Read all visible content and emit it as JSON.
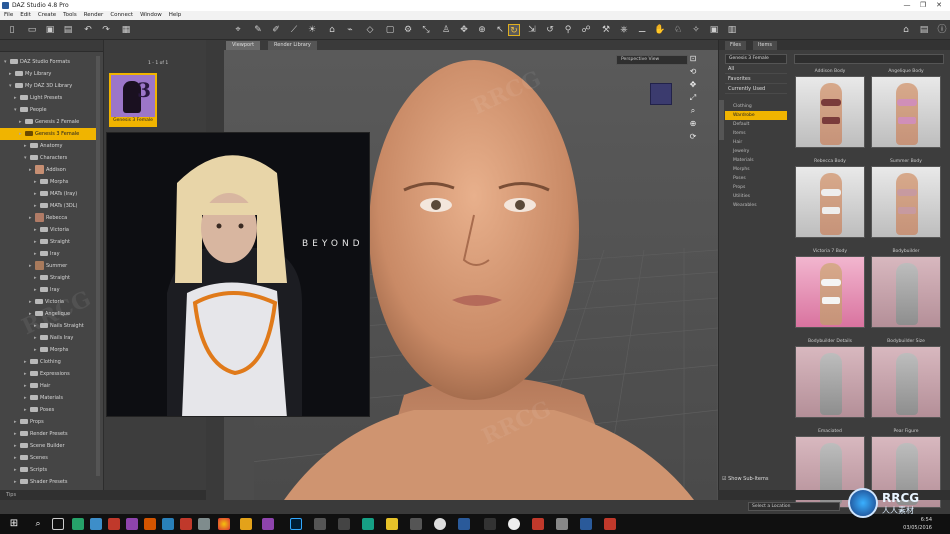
{
  "window": {
    "title": "DAZ Studio 4.8 Pro",
    "controls": [
      "—",
      "❐",
      "✕"
    ]
  },
  "menu": [
    "File",
    "Edit",
    "Create",
    "Tools",
    "Render",
    "Connect",
    "Window",
    "Help"
  ],
  "viewport": {
    "tabs": [
      "Viewport",
      "Render Library"
    ],
    "camera": "Perspective View",
    "promo_text": "BEYOND"
  },
  "content_library": {
    "page_indicator": "1 - 1 of 1",
    "tree": [
      {
        "label": "DAZ Studio Formats",
        "depth": 0,
        "open": true
      },
      {
        "label": "My Library",
        "depth": 1
      },
      {
        "label": "My DAZ 3D Library",
        "depth": 1,
        "open": true
      },
      {
        "label": "Light Presets",
        "depth": 2
      },
      {
        "label": "People",
        "depth": 2,
        "open": true
      },
      {
        "label": "Genesis 2 Female",
        "depth": 3
      },
      {
        "label": "Genesis 3 Female",
        "depth": 3,
        "selected": true
      },
      {
        "label": "Anatomy",
        "depth": 4
      },
      {
        "label": "Characters",
        "depth": 4,
        "open": true
      },
      {
        "label": "Addison",
        "depth": 5,
        "thumb": "#c78f73"
      },
      {
        "label": "Morphs",
        "depth": 6
      },
      {
        "label": "MATs (Iray)",
        "depth": 6
      },
      {
        "label": "MATs (3DL)",
        "depth": 6
      },
      {
        "label": "Rebecca",
        "depth": 5,
        "thumb": "#b07b66"
      },
      {
        "label": "Victoria",
        "depth": 6
      },
      {
        "label": "Straight",
        "depth": 6
      },
      {
        "label": "Iray",
        "depth": 6
      },
      {
        "label": "Summer",
        "depth": 5,
        "thumb": "#a87a5c"
      },
      {
        "label": "Straight",
        "depth": 6
      },
      {
        "label": "Iray",
        "depth": 6
      },
      {
        "label": "Victoria",
        "depth": 5
      },
      {
        "label": "Angelique",
        "depth": 5
      },
      {
        "label": "Nails Straight",
        "depth": 6
      },
      {
        "label": "Nails Iray",
        "depth": 6
      },
      {
        "label": "Morphs",
        "depth": 6
      },
      {
        "label": "Clothing",
        "depth": 4
      },
      {
        "label": "Expressions",
        "depth": 4
      },
      {
        "label": "Hair",
        "depth": 4
      },
      {
        "label": "Materials",
        "depth": 4
      },
      {
        "label": "Poses",
        "depth": 4
      },
      {
        "label": "Props",
        "depth": 2
      },
      {
        "label": "Render Presets",
        "depth": 2
      },
      {
        "label": "Scene Builder",
        "depth": 2
      },
      {
        "label": "Scenes",
        "depth": 2
      },
      {
        "label": "Scripts",
        "depth": 2
      },
      {
        "label": "Shader Presets",
        "depth": 2
      }
    ],
    "selected_item": "Genesis 3 Female",
    "tip_label": "Tips"
  },
  "smart_content": {
    "tabs": [
      "Files",
      "Items"
    ],
    "filter": "Genesis 3 Female",
    "options": [
      "All",
      "Favorites",
      "Currently Used"
    ],
    "tree": [
      "Clothing",
      "Wardrobe",
      "Default",
      "Items",
      "Hair",
      "Jewelry",
      "Materials",
      "Morphs",
      "Poses",
      "Props",
      "Utilities",
      "Wearables"
    ],
    "tree_selected": "Wardrobe",
    "cards": [
      {
        "title": "Addison Body",
        "skin": "skin",
        "top": "#7a3b3b",
        "bottom": "#7a3b3b"
      },
      {
        "title": "Angelique Body",
        "skin": "skin",
        "top": "#d08fb8",
        "bottom": "#d08fb8"
      },
      {
        "title": "Rebecca Body",
        "skin": "skin",
        "top": "#eeeeee",
        "bottom": "#eeeeee"
      },
      {
        "title": "Summer Body",
        "skin": "skin",
        "top": "#c79aa0",
        "bottom": "#c79aa0"
      },
      {
        "title": "Victoria 7 Body",
        "skin": "skin",
        "top": "#f4f4f4",
        "bottom": "#f4f4f4"
      },
      {
        "title": "Bodybuilder",
        "skin": "grey",
        "top": "",
        "bottom": ""
      },
      {
        "title": "Bodybuilder Details",
        "skin": "grey",
        "top": "",
        "bottom": ""
      },
      {
        "title": "Bodybuilder Size",
        "skin": "grey",
        "top": "",
        "bottom": ""
      },
      {
        "title": "Emaciated",
        "skin": "grey",
        "top": "",
        "bottom": ""
      },
      {
        "title": "Pear Figure",
        "skin": "grey",
        "top": "",
        "bottom": ""
      }
    ],
    "show_sub_items": "Show Sub-Items",
    "location_dd": "Select a Location"
  },
  "taskbar": {
    "time": "6:54",
    "date": "03/05/2016"
  },
  "brand": {
    "name": "RRCG",
    "sub": "人人素材"
  },
  "watermark": "RRCG"
}
